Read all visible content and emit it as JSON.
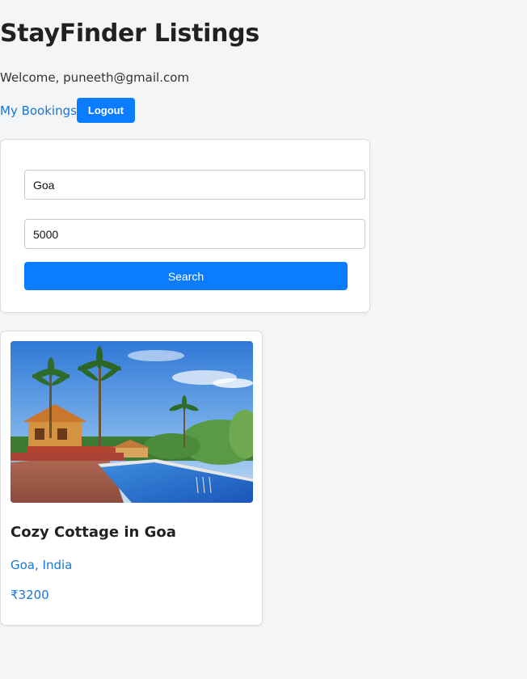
{
  "header": {
    "title": "StayFinder Listings",
    "welcome": "Welcome, puneeth@gmail.com"
  },
  "nav": {
    "bookings_label": "My Bookings",
    "logout_label": "Logout"
  },
  "search": {
    "location_value": "Goa",
    "price_value": "5000",
    "button_label": "Search"
  },
  "listings": [
    {
      "title": "Cozy Cottage in Goa",
      "location": "Goa, India",
      "price": "₹3200"
    }
  ],
  "colors": {
    "accent": "#0a7cff",
    "link": "#1877d2",
    "background": "#f4f5f7"
  }
}
